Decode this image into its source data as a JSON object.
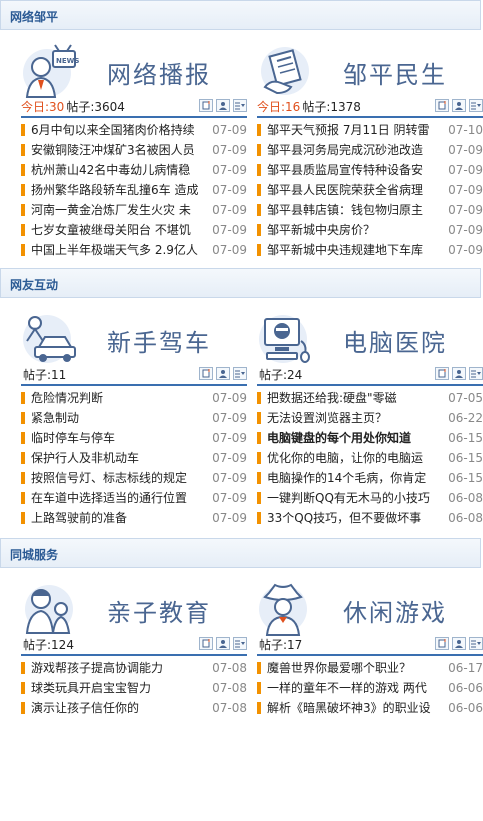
{
  "sections": [
    {
      "title": "网络邹平",
      "cards": [
        {
          "icon": "news-reporter-icon",
          "title": "网络播报",
          "today": "今日:30",
          "posts": "帖子:3604",
          "items": [
            {
              "title": "6月中旬以来全国猪肉价格持续",
              "date": "07-09"
            },
            {
              "title": "安徽铜陵汪冲煤矿3名被困人员",
              "date": "07-09"
            },
            {
              "title": "杭州萧山42名中毒幼儿病情稳",
              "date": "07-09"
            },
            {
              "title": "扬州繁华路段轿车乱撞6车 造成",
              "date": "07-09"
            },
            {
              "title": "河南一黄金冶炼厂发生火灾 未",
              "date": "07-09"
            },
            {
              "title": "七岁女童被继母关阳台 不堪饥",
              "date": "07-09"
            },
            {
              "title": "中国上半年极端天气多 2.9亿人",
              "date": "07-09"
            }
          ]
        },
        {
          "icon": "newspaper-hand-icon",
          "title": "邹平民生",
          "today": "今日:16",
          "posts": "帖子:1378",
          "items": [
            {
              "title": "邹平天气预报 7月11日 阴转雷",
              "date": "07-10"
            },
            {
              "title": "邹平县河务局完成沉砂池改造",
              "date": "07-09"
            },
            {
              "title": "邹平县质监局宣传特种设备安",
              "date": "07-09"
            },
            {
              "title": "邹平县人民医院荣获全省病理",
              "date": "07-09"
            },
            {
              "title": "邹平县韩店镇：钱包物归原主",
              "date": "07-09"
            },
            {
              "title": "邹平新城中央房价？",
              "date": "07-09"
            },
            {
              "title": "邹平新城中央违规建地下车库",
              "date": "07-09"
            }
          ]
        }
      ]
    },
    {
      "title": "网友互动",
      "cards": [
        {
          "icon": "driver-car-icon",
          "title": "新手驾车",
          "today": "",
          "posts": "帖子:11",
          "items": [
            {
              "title": "危险情况判断",
              "date": "07-09"
            },
            {
              "title": "紧急制动",
              "date": "07-09"
            },
            {
              "title": "临时停车与停车",
              "date": "07-09"
            },
            {
              "title": "保护行人及非机动车",
              "date": "07-09"
            },
            {
              "title": "按照信号灯、标志标线的规定",
              "date": "07-09"
            },
            {
              "title": "在车道中选择适当的通行位置",
              "date": "07-09"
            },
            {
              "title": "上路驾驶前的准备",
              "date": "07-09"
            }
          ]
        },
        {
          "icon": "computer-doctor-icon",
          "title": "电脑医院",
          "today": "",
          "posts": "帖子:24",
          "items": [
            {
              "title": "把数据还给我:硬盘\"零磁",
              "date": "07-05"
            },
            {
              "title": "无法设置浏览器主页？",
              "date": "06-22"
            },
            {
              "title": "电脑键盘的每个用处你知道",
              "date": "06-15",
              "bold": true
            },
            {
              "title": "优化你的电脑，让你的电脑运",
              "date": "06-15"
            },
            {
              "title": "电脑操作的14个毛病，你肯定",
              "date": "06-15"
            },
            {
              "title": "一键判断QQ有无木马的小技巧",
              "date": "06-08"
            },
            {
              "title": "33个QQ技巧，但不要做坏事",
              "date": "06-08"
            }
          ]
        }
      ]
    },
    {
      "title": "同城服务",
      "cards": [
        {
          "icon": "mother-child-icon",
          "title": "亲子教育",
          "today": "",
          "posts": "帖子:124",
          "items": [
            {
              "title": "游戏帮孩子提高协调能力",
              "date": "07-08"
            },
            {
              "title": "球类玩具开启宝宝智力",
              "date": "07-08"
            },
            {
              "title": "演示让孩子信任你的",
              "date": "07-08"
            }
          ]
        },
        {
          "icon": "cowboy-icon",
          "title": "休闲游戏",
          "today": "",
          "posts": "帖子:17",
          "items": [
            {
              "title": "魔兽世界你最爱哪个职业？",
              "date": "06-17"
            },
            {
              "title": "一样的童年不一样的游戏 两代",
              "date": "06-06"
            },
            {
              "title": "解析《暗黑破坏神3》的职业设",
              "date": "06-06"
            }
          ]
        }
      ]
    }
  ],
  "toolbar_icons": [
    "new-post-icon",
    "user-icon",
    "list-dropdown-icon"
  ],
  "colors": {
    "accent": "#f29100",
    "today": "#e0501d",
    "title": "#4a6691",
    "rule": "#3a6fb0",
    "section": "#2b5a94"
  }
}
